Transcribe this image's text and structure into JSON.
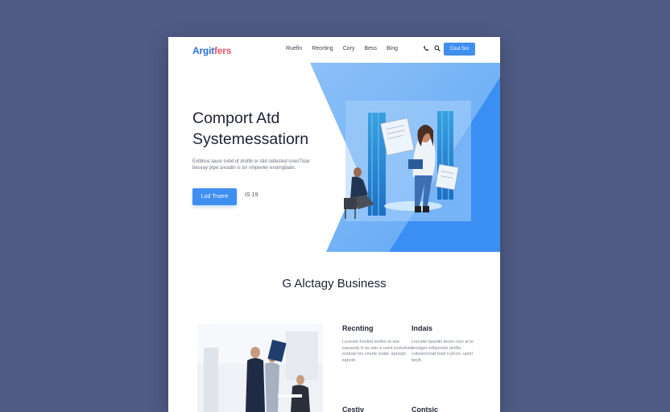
{
  "header": {
    "logo_main": "Argit",
    "logo_accent": "fers",
    "nav": [
      "Ruefin",
      "Reorting",
      "Cory",
      "Bess",
      "Bing"
    ],
    "icons": [
      "phone-icon",
      "search-icon"
    ],
    "cta_label": "Cout Sro"
  },
  "hero": {
    "title_line1": "Comport Atd",
    "title_line2": "Systemessatiorn",
    "description": "Extbhos laure svbd of drotfe or stid rattested cnesTloar besvay ptpe.sreadin is tor ninpevier enoingbiain.",
    "button_label": "Lod Trsere",
    "link_label": "IS 19"
  },
  "section": {
    "title": "G Alctagy Business"
  },
  "features": [
    {
      "title": "Recnting",
      "text": "Lounote Fenlnd serfeo st soe trauserlp tt os ootr a cetnt tcoeohvio sortuwi tvo ceerte ciutal. aprsopt lugvoit."
    },
    {
      "title": "Indais",
      "text": "Lrecsite lasedin tecos cors al to leustgel ortlarerets serllia cotoserrcoaf tosd o prcre. upotl beylt."
    },
    {
      "title": "Cestiv",
      "text": ""
    },
    {
      "title": "Contsic",
      "text": ""
    }
  ],
  "colors": {
    "background": "#505c85",
    "accent": "#3f8ff0",
    "logo_accent": "#e2566d",
    "hero_shape_light": "#7fb8f7",
    "hero_shape_dark": "#3a8ef2"
  }
}
